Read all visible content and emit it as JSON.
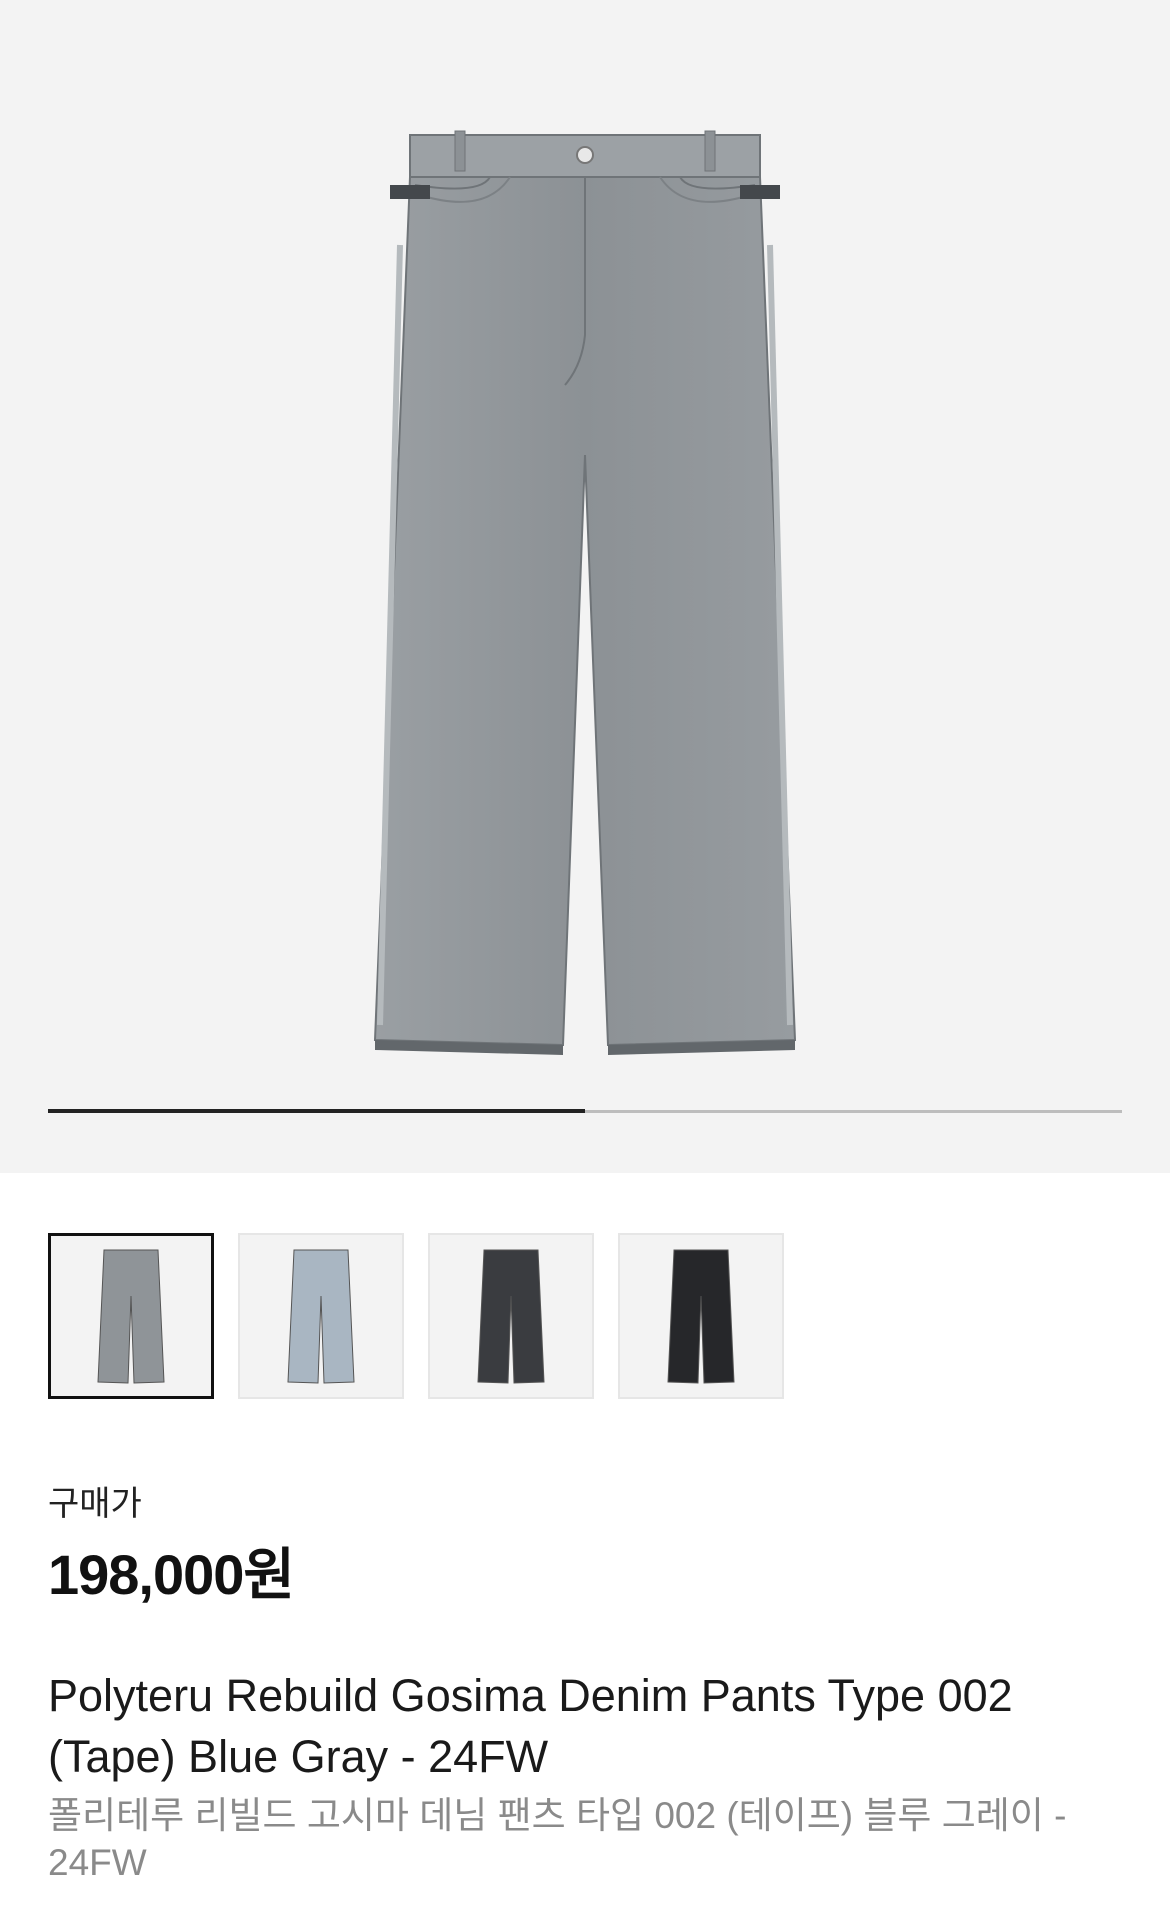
{
  "product": {
    "image_icon": "denim-pants-icon",
    "gallery_progress": 0.5,
    "thumbnails": [
      {
        "name": "thumbnail-blue-gray",
        "color": "#8f9498",
        "selected": true
      },
      {
        "name": "thumbnail-light-blue",
        "color": "#a9b6c2",
        "selected": false
      },
      {
        "name": "thumbnail-charcoal",
        "color": "#3a3c40",
        "selected": false
      },
      {
        "name": "thumbnail-black",
        "color": "#26272a",
        "selected": false
      }
    ],
    "price_label": "구매가",
    "price": "198,000원",
    "name_en": "Polyteru Rebuild Gosima Denim Pants Type 002 (Tape) Blue Gray - 24FW",
    "name_ko": "폴리테루 리빌드 고시마 데님 팬츠 타입 002 (테이프) 블루 그레이 - 24FW"
  },
  "colors": {
    "hero_bg": "#f3f3f3",
    "accent": "#111111",
    "secondary_text": "#8a8a8a"
  }
}
